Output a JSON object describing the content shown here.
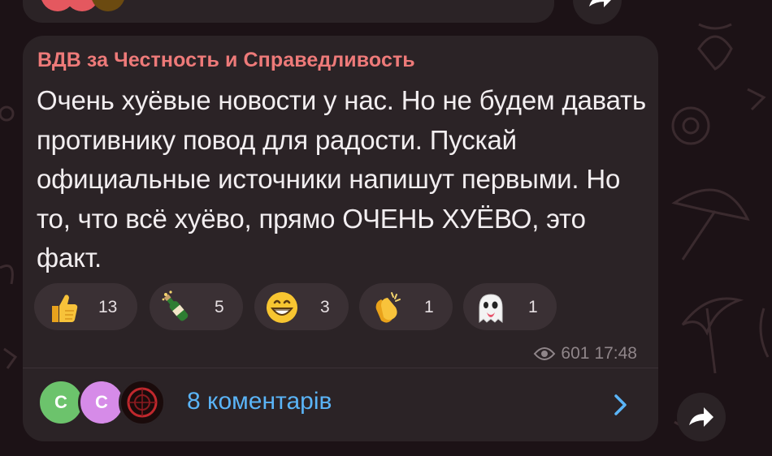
{
  "post": {
    "channel_name": "ВДВ за Честность и Справедливость",
    "text": "Очень хуёвые новости у нас. Но не будем давать противнику повод для радости. Пускай официальные источники напишут первыми. Но то, что всё хуёво, прямо ОЧЕНЬ ХУЁВО, это факт.",
    "views": "601",
    "time": "17:48"
  },
  "reactions": [
    {
      "icon": "thumbs-up-icon",
      "count": "13"
    },
    {
      "icon": "champagne-icon",
      "count": "5"
    },
    {
      "icon": "grinning-face-icon",
      "count": "3"
    },
    {
      "icon": "clapping-hands-icon",
      "count": "1"
    },
    {
      "icon": "ghost-icon",
      "count": "1"
    }
  ],
  "comments": {
    "label": "8 коментарів",
    "avatars": [
      {
        "initial": "C",
        "color": "#6cc36c"
      },
      {
        "initial": "C",
        "color": "#d68be8"
      },
      {
        "initial": "",
        "color": "#1a0b0b"
      }
    ]
  },
  "colors": {
    "background": "#1c1216",
    "bubble": "#2b2326",
    "channel_name": "#ee7a79",
    "link": "#5ab4f7"
  }
}
